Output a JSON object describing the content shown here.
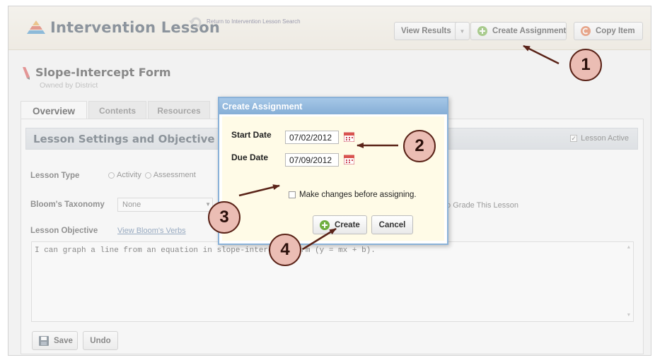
{
  "header": {
    "app_title": "Intervention Lesson",
    "return_link": "Return to Intervention Lesson Search",
    "buttons": {
      "view_results": "View Results",
      "create_assignment": "Create Assignment",
      "copy_item": "Copy Item"
    }
  },
  "lesson": {
    "title": "Slope-Intercept Form",
    "owner": "Owned by District"
  },
  "tabs": [
    "Overview",
    "Contents",
    "Resources"
  ],
  "panel": {
    "title": "Lesson Settings and Objective",
    "lesson_active_label": "Lesson Active",
    "lesson_active_checked": true,
    "lesson_type_label": "Lesson Type",
    "lesson_type_options": [
      "Activity",
      "Assessment"
    ],
    "bloom_label": "Bloom's Taxonomy",
    "bloom_value": "None",
    "grade_text": "to Grade This Lesson",
    "objective_label": "Lesson Objective",
    "view_verbs_link": "View Bloom's Verbs",
    "objective_text": "I can graph a line from an equation in slope-intercept form (y = mx + b).",
    "save_label": "Save",
    "undo_label": "Undo"
  },
  "dialog": {
    "title": "Create Assignment",
    "start_date_label": "Start Date",
    "start_date_value": "07/02/2012",
    "due_date_label": "Due Date",
    "due_date_value": "07/09/2012",
    "make_changes_label": "Make changes before assigning.",
    "make_changes_checked": false,
    "create_label": "Create",
    "cancel_label": "Cancel"
  },
  "callouts": [
    "1",
    "2",
    "3",
    "4"
  ],
  "icons": {
    "logo": "pyramid-logo-icon",
    "return": "return-arrow-icon",
    "create_assignment": "plus-circle-icon",
    "copy_item": "copy-circle-icon",
    "lesson": "pencil-icon",
    "calendar": "calendar-icon",
    "save": "floppy-disk-icon"
  },
  "colors": {
    "accent_green": "#6fae3f",
    "copy_orange": "#e06a3a",
    "dialog_blue": "#8ab2d8",
    "callout_fill": "#ebbdb4",
    "arrow_color": "#5a2318"
  }
}
